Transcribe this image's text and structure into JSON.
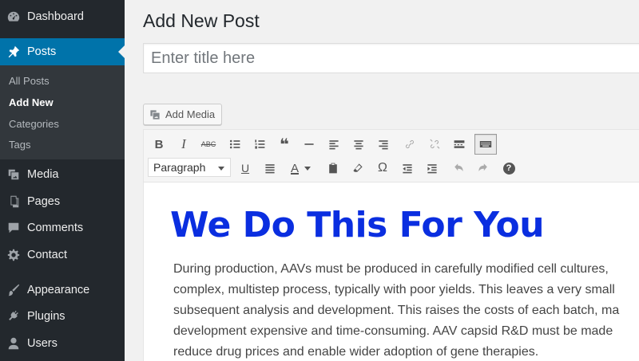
{
  "sidebar": {
    "dashboard": "Dashboard",
    "posts": "Posts",
    "submenu": {
      "all_posts": "All Posts",
      "add_new": "Add New",
      "categories": "Categories",
      "tags": "Tags"
    },
    "media": "Media",
    "pages": "Pages",
    "comments": "Comments",
    "contact": "Contact",
    "appearance": "Appearance",
    "plugins": "Plugins",
    "users": "Users"
  },
  "main": {
    "page_title": "Add New Post",
    "title_placeholder": "Enter title here",
    "add_media": "Add Media"
  },
  "toolbar": {
    "format_value": "Paragraph",
    "bold": "B",
    "italic": "I",
    "strike": "ABC",
    "quote": "❝",
    "underline": "U",
    "text_color": "A",
    "omega": "Ω",
    "help": "?"
  },
  "content": {
    "heading": "We Do This For You",
    "paragraph_lines": [
      "During production, AAVs must be produced in carefully modified cell cultures,",
      "complex, multistep process, typically with poor yields. This leaves a very small",
      "subsequent analysis and development. This raises the costs of each batch, ma",
      "development expensive and time-consuming. AAV capsid R&D must be made",
      "reduce drug prices and enable wider adoption of gene therapies."
    ]
  },
  "colors": {
    "sidebar_bg": "#23282d",
    "active_menu": "#0073aa",
    "heading_blue": "#0a2ee0"
  }
}
